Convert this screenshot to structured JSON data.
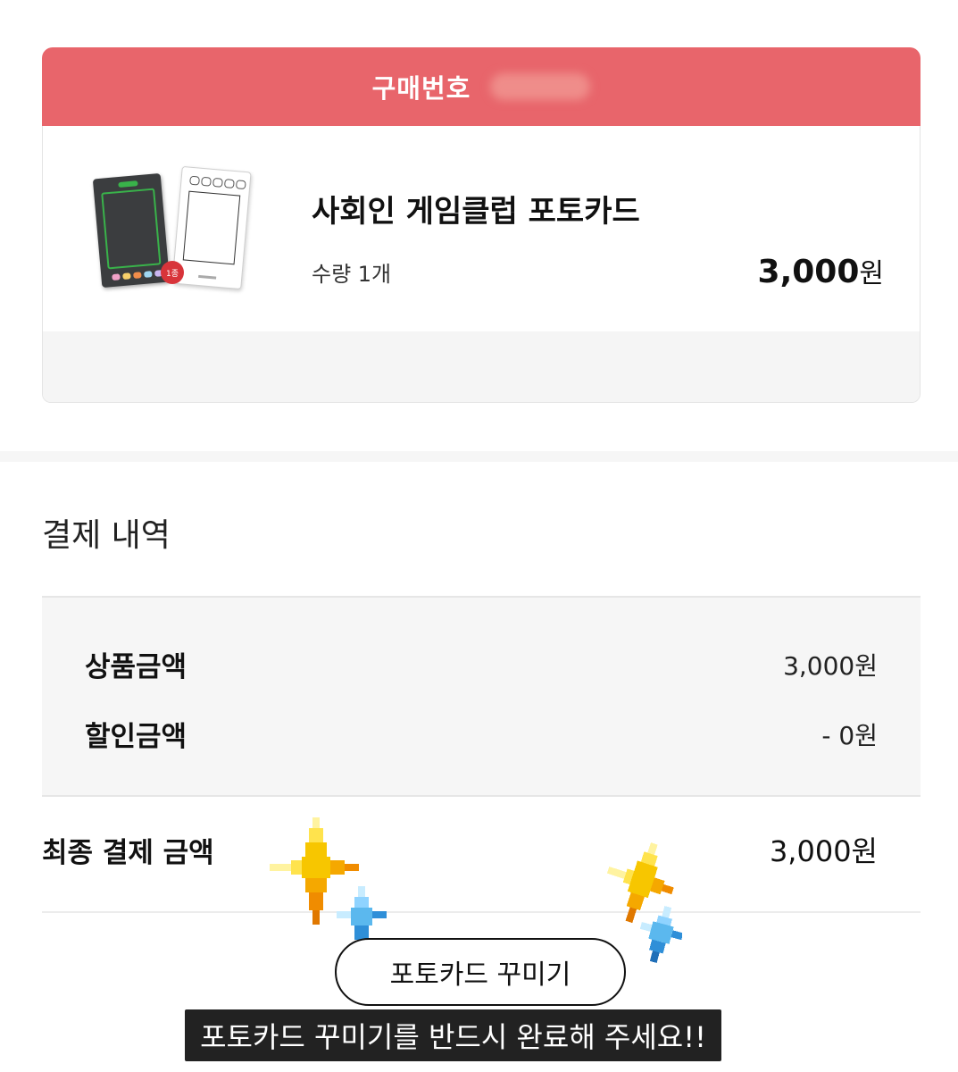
{
  "order": {
    "label": "구매번호"
  },
  "product": {
    "name": "사회인 게임클럽 포토카드",
    "quantity": "수량 1개",
    "price_number": "3,000",
    "price_unit": "원",
    "badge": "1종"
  },
  "payment": {
    "title": "결제 내역",
    "rows": [
      {
        "label": "상품금액",
        "value": "3,000원"
      },
      {
        "label": "할인금액",
        "value": "- 0원"
      }
    ],
    "final_label": "최종 결제 금액",
    "final_value": "3,000원"
  },
  "actions": {
    "decorate_label": "포토카드 꾸미기"
  },
  "caption": "포토카드 꾸미기를 반드시 완료해 주세요!!",
  "colors": {
    "banner": "#e8656b",
    "caption_bg": "#222222",
    "sparkle_yellow": "#f7c600",
    "sparkle_blue": "#5bb8ee"
  },
  "icons": {
    "sparkles": [
      "sparkle-yellow-icon",
      "sparkle-blue-icon"
    ]
  }
}
